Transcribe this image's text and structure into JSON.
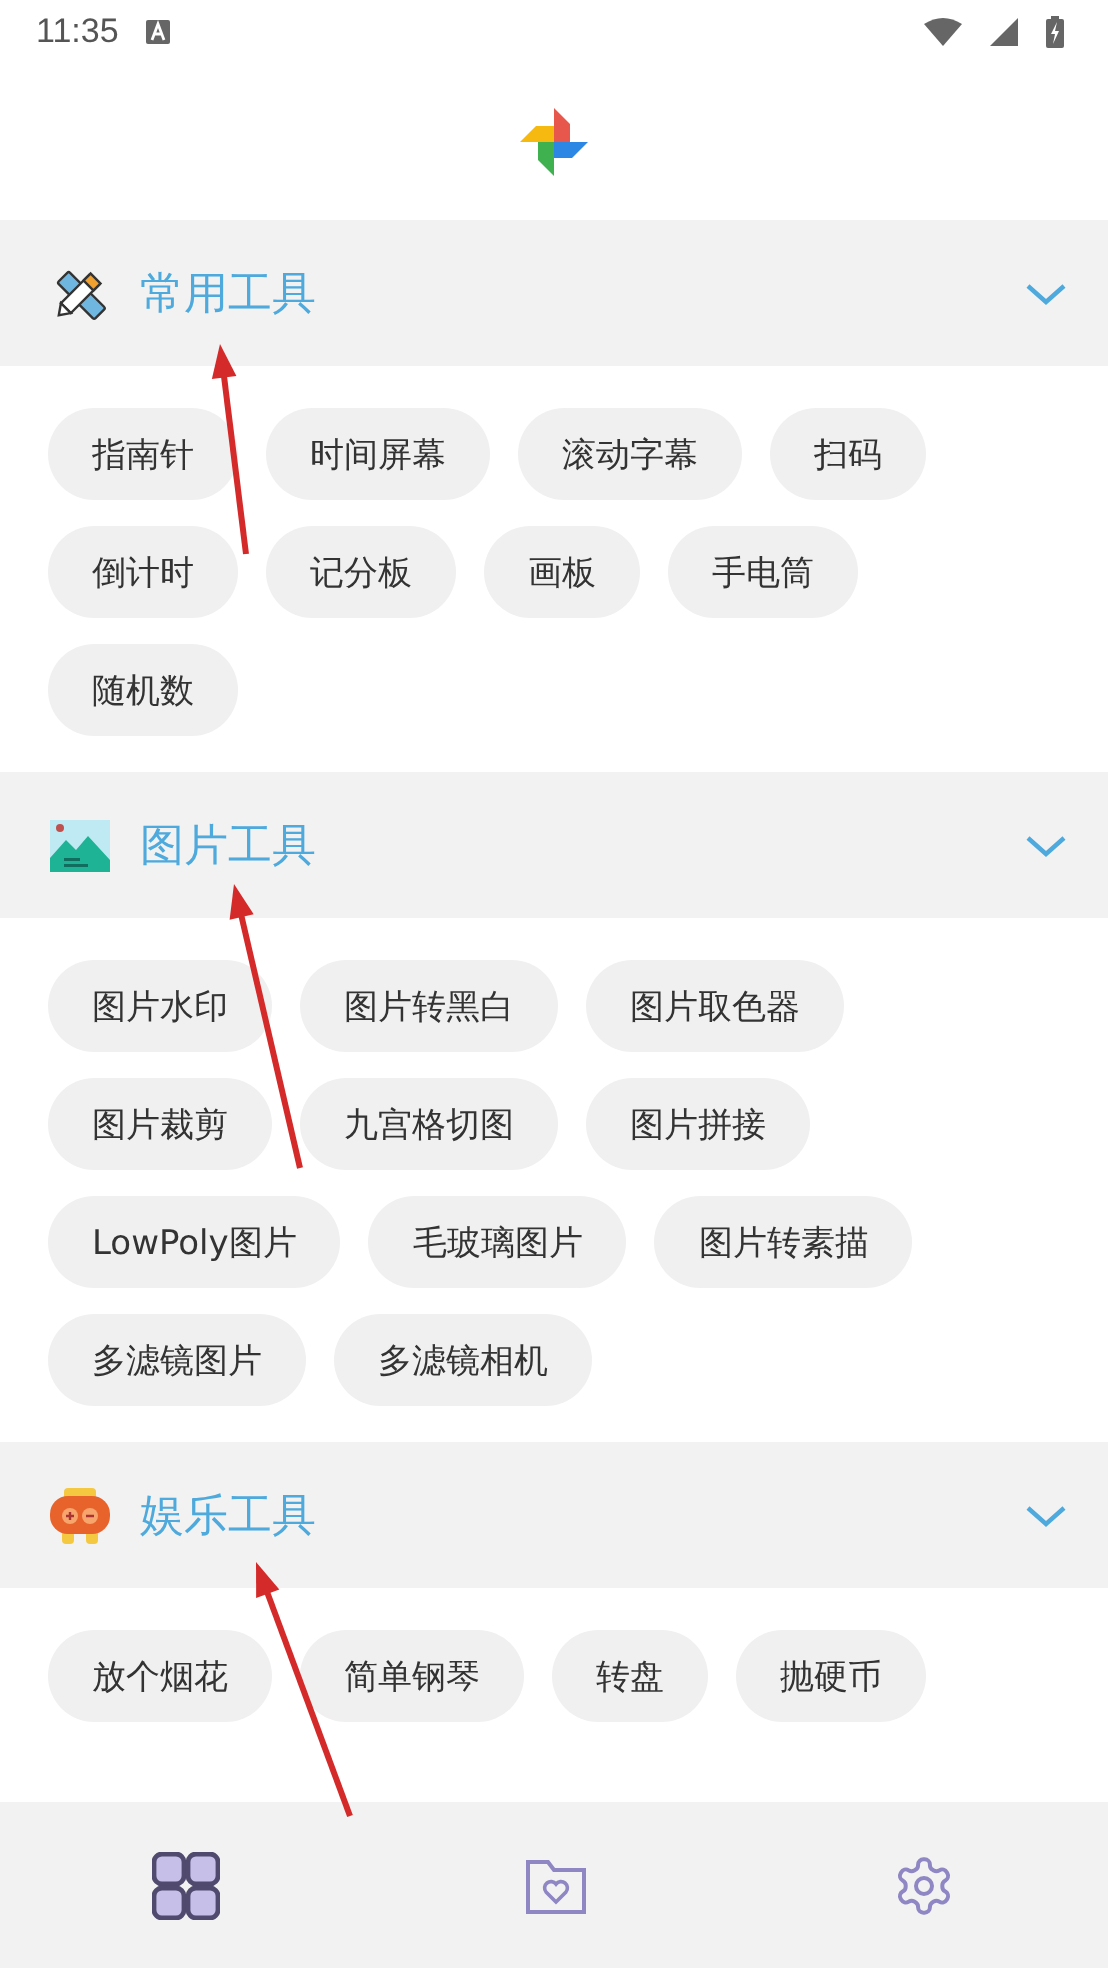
{
  "status_bar": {
    "time": "11:35"
  },
  "sections": [
    {
      "kind": "tools",
      "title": "常用工具",
      "expanded": true,
      "arrow": true,
      "items": [
        "指南针",
        "时间屏幕",
        "滚动字幕",
        "扫码",
        "倒计时",
        "记分板",
        "画板",
        "手电筒",
        "随机数"
      ]
    },
    {
      "kind": "picture",
      "title": "图片工具",
      "expanded": true,
      "arrow": true,
      "items": [
        "图片水印",
        "图片转黑白",
        "图片取色器",
        "图片裁剪",
        "九宫格切图",
        "图片拼接",
        "LowPoly图片",
        "毛玻璃图片",
        "图片转素描",
        "多滤镜图片",
        "多滤镜相机"
      ]
    },
    {
      "kind": "fun",
      "title": "娱乐工具",
      "expanded": true,
      "arrow": true,
      "items": [
        "放个烟花",
        "简单钢琴",
        "转盘",
        "抛硬币"
      ]
    }
  ],
  "bottom_nav": [
    {
      "kind": "home",
      "selected": true
    },
    {
      "kind": "favorites",
      "selected": false
    },
    {
      "kind": "settings",
      "selected": false
    }
  ]
}
